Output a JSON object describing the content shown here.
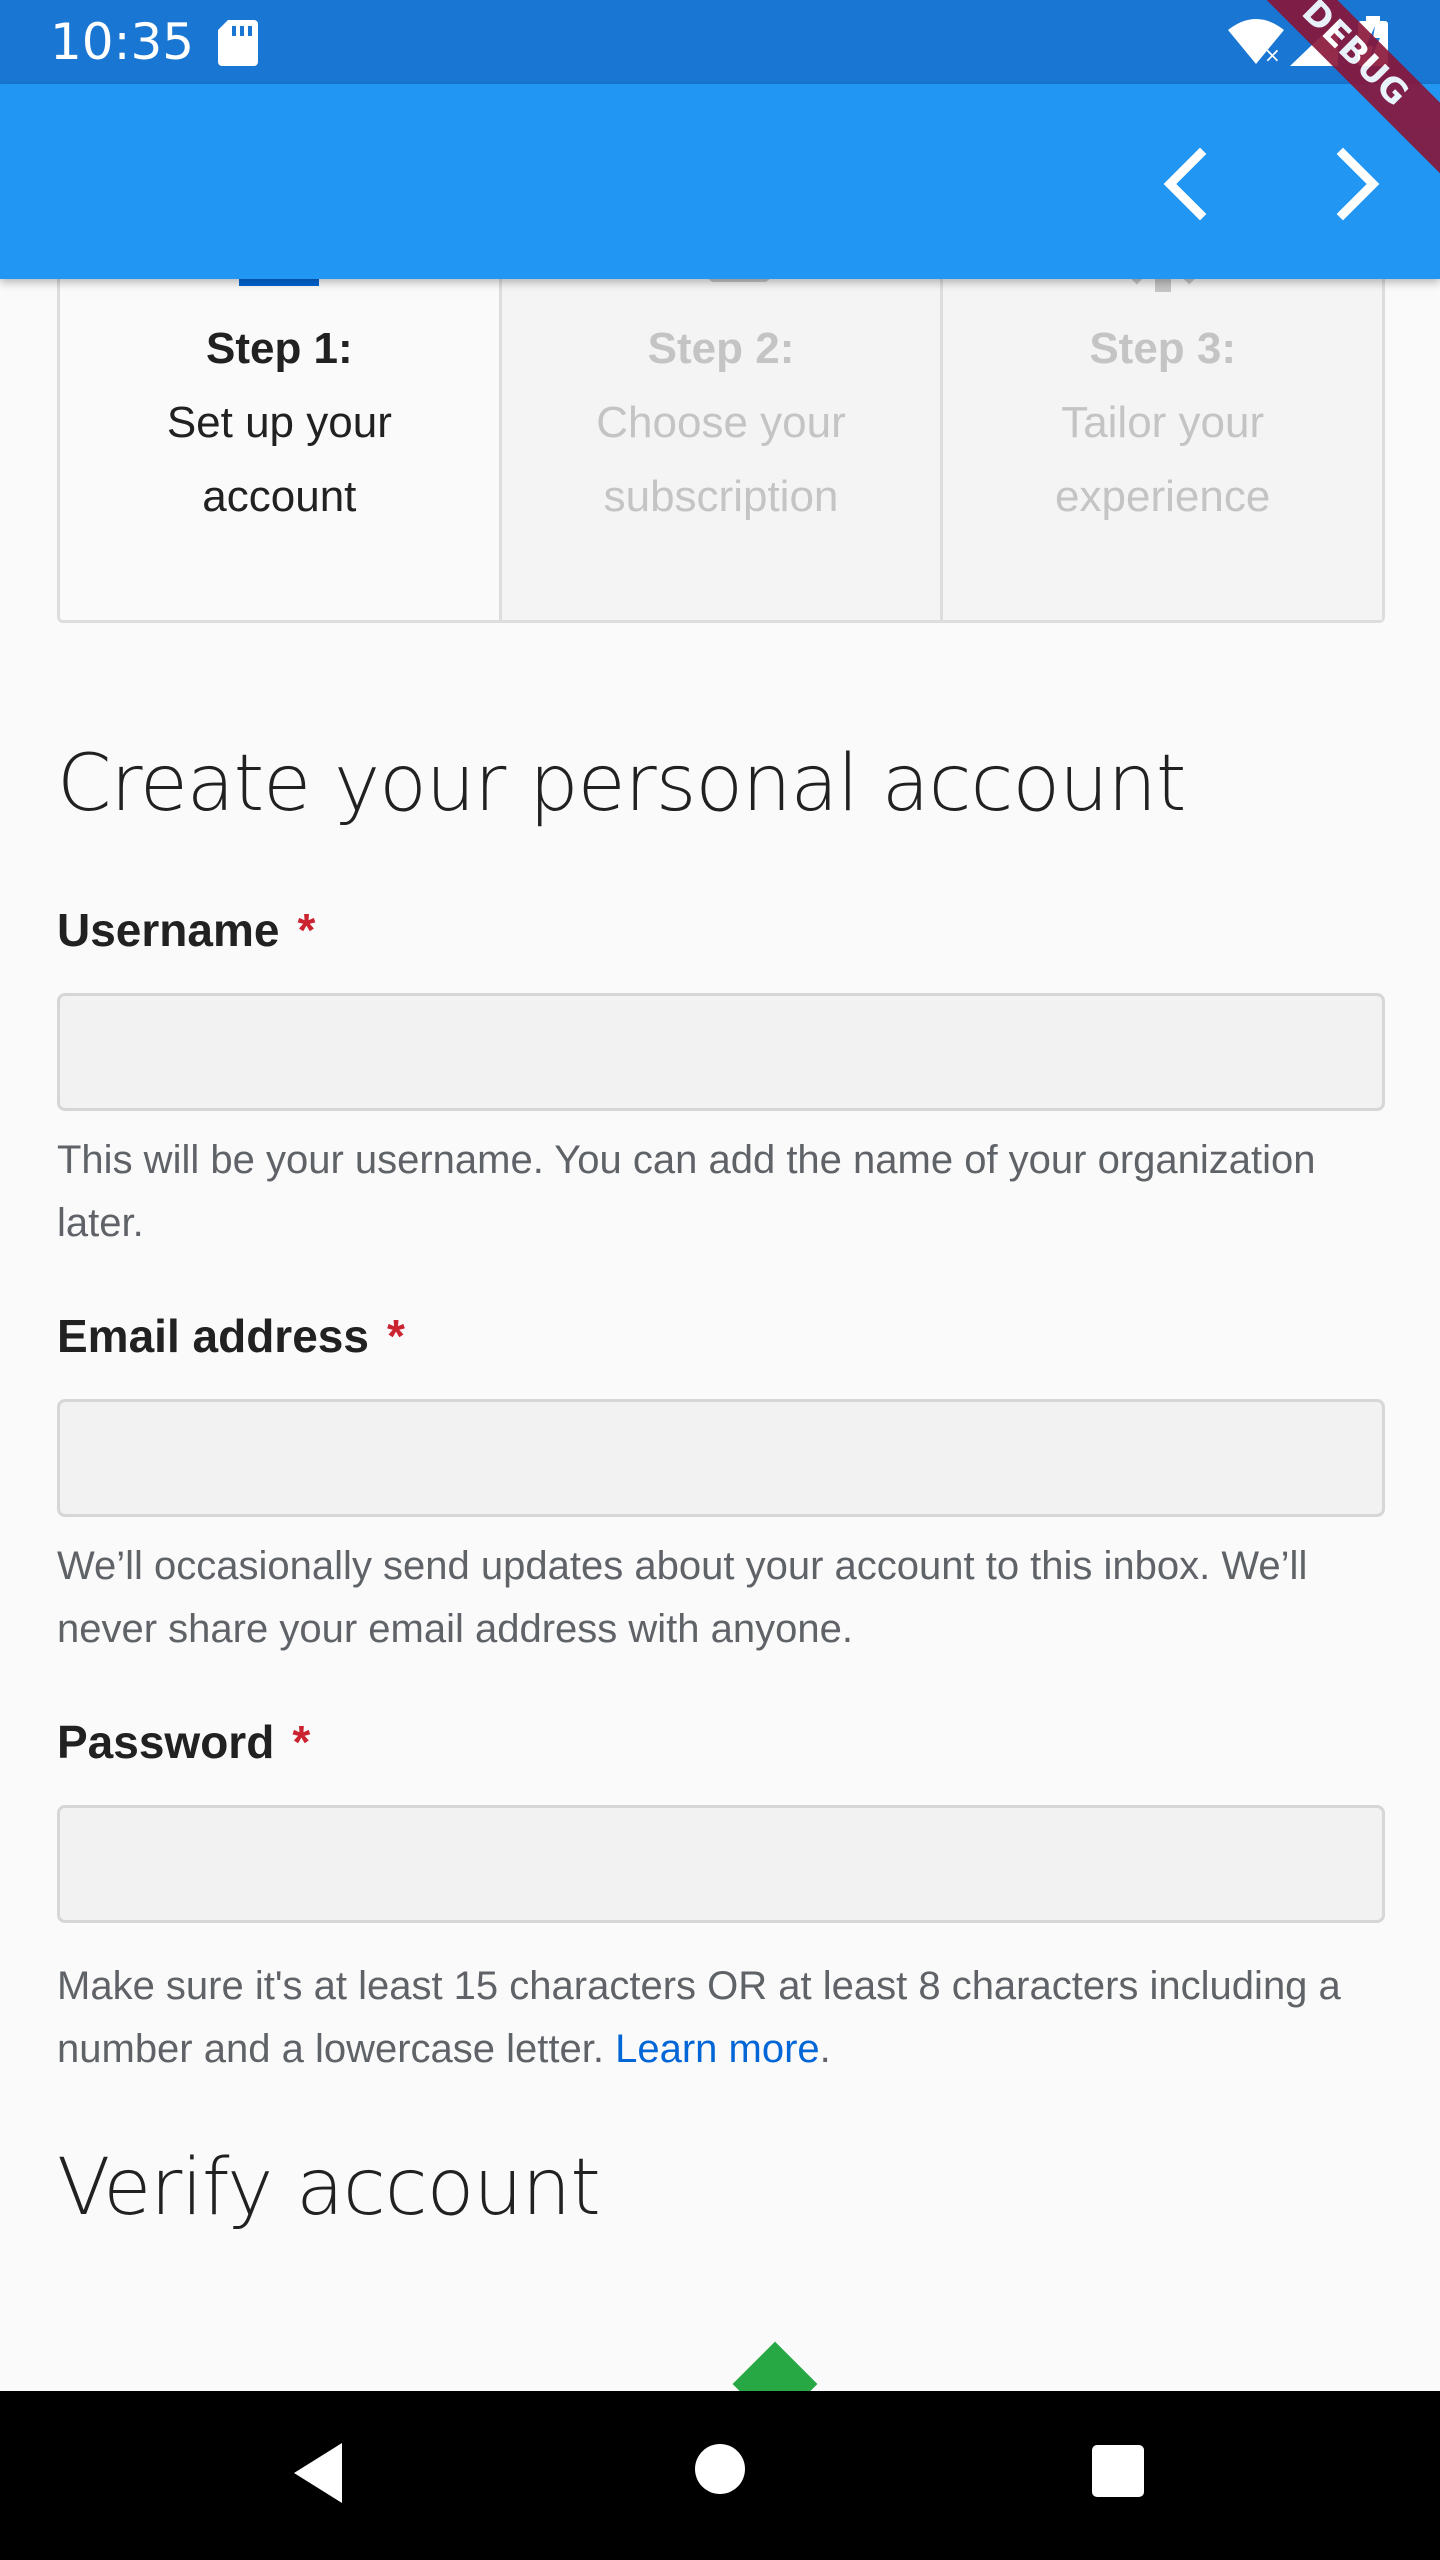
{
  "status_bar": {
    "time": "10:35"
  },
  "app_bar": {
    "debug_label": "DEBUG"
  },
  "steps": [
    {
      "title": "Step 1:",
      "line1": "Set up your",
      "line2": "account",
      "icon": "person-icon"
    },
    {
      "title": "Step 2:",
      "line1": "Choose your",
      "line2": "subscription",
      "icon": "devices-icon"
    },
    {
      "title": "Step 3:",
      "line1": "Tailor your",
      "line2": "experience",
      "icon": "gear-icon"
    }
  ],
  "form": {
    "heading": "Create your personal account",
    "username": {
      "label": "Username",
      "required": "*",
      "value": "",
      "help": "This will be your username. You can add the name of your organization later."
    },
    "email": {
      "label": "Email address",
      "required": "*",
      "value": "",
      "help": "We’ll occasionally send updates about your account to this inbox. We’ll never share your email address with anyone."
    },
    "password": {
      "label": "Password",
      "required": "*",
      "value": "",
      "help_prefix": "Make sure it's at least 15 characters OR at least 8 characters including a number and a lowercase letter. ",
      "help_link": "Learn more",
      "help_suffix": "."
    }
  },
  "verify": {
    "heading": "Verify account"
  },
  "colors": {
    "status_bar": "#1976d2",
    "app_bar": "#2196f3",
    "accent_blue": "#0366d6",
    "required_red": "#cb2431",
    "step_active_icon": "#0366d6",
    "step_inactive": "#c4c4c4"
  }
}
